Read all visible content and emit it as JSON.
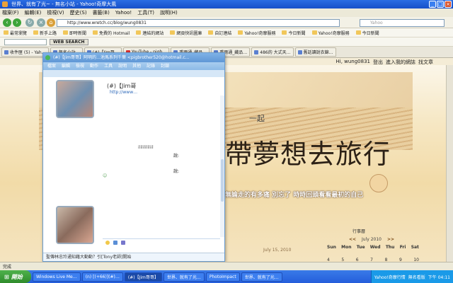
{
  "browser": {
    "title": "世界、就有了光~ - 無名小站 - Yahoo!奇摩大風",
    "menu": [
      "檔案(F)",
      "編輯(E)",
      "檢視(V)",
      "歷史(S)",
      "書籤(B)",
      "Yahoo!",
      "工具(T)",
      "說明(H)"
    ],
    "address": "http://www.wretch.cc/blog/wung0831",
    "search_placeholder": "Yahoo",
    "favorites": [
      "最常瀏覽",
      "新手上路",
      "即時新聞",
      "免費的 Hotmail",
      "連結的網站",
      "網頁快訊圖庫",
      "自訂連結",
      "Yahoo!奇摩服務",
      "今日新聞",
      "Yahoo!奇摩服務",
      "今日新聞"
    ],
    "web_search": "WEB SEARCH",
    "tabs": [
      "收件匣 (5) - Yah…",
      "無名小站…",
      "(#)【Jim哥…",
      "YouTube - pigb…",
      "重雨通_藏品…",
      "重雨通_藏品…",
      "486的 大式天…",
      "舊話讀說衣錦…"
    ],
    "status": "完成"
  },
  "blog": {
    "user_links": [
      "Hi, wung0831",
      "登出",
      "進入我的網誌",
      "找文章"
    ],
    "header_together": "一起",
    "header_main": "帶夢想去旅行",
    "slogan": "無論走的有多痛   別忘了  時時回頭看看最初的自己",
    "date": "July 15, 2010",
    "cal_title": "行事曆",
    "cal_month": "July 2010",
    "cal_prev": "<<",
    "cal_next": ">>",
    "cal_days": [
      "Sun",
      "Mon",
      "Tue",
      "Wed",
      "Thu",
      "Fri",
      "Sat"
    ],
    "cal_row": [
      "4",
      "5",
      "6",
      "7",
      "8",
      "9",
      "10"
    ]
  },
  "msn": {
    "title": "(#)【Jim哥哥】阿明的…池馬系列千葉 <pigbrother520@hotmail.c…",
    "menu": [
      "檔案",
      "編輯",
      "檢視",
      "動作",
      "工具",
      "說明",
      "其他",
      "記錄",
      "封鎖"
    ],
    "contact_name": "(#)【Jim哥",
    "contact_email": "http://www…",
    "chat_fragments": [
      "說:",
      "說:",
      "ilililililiil"
    ],
    "status": "聖傳林忠玲通知藉大動動？引[Tony老師]開始"
  },
  "taskbar": {
    "start": "開始",
    "tasks": [
      "Windows Live Me…",
      "(n) [(+66)](#)…",
      "(#)【Jim哥哥】",
      "世界、就有了光…",
      "PhotoImpact",
      "世界、就有了光…"
    ],
    "tray": [
      "Yahoo!奇摩行情",
      "無名看版"
    ],
    "time": "下午 04:11"
  },
  "colors": {
    "title_blue": "#1750c9",
    "taskbar_blue": "#245edb",
    "start_green": "#2f8c2c",
    "msn_blue": "#5f97d6"
  }
}
